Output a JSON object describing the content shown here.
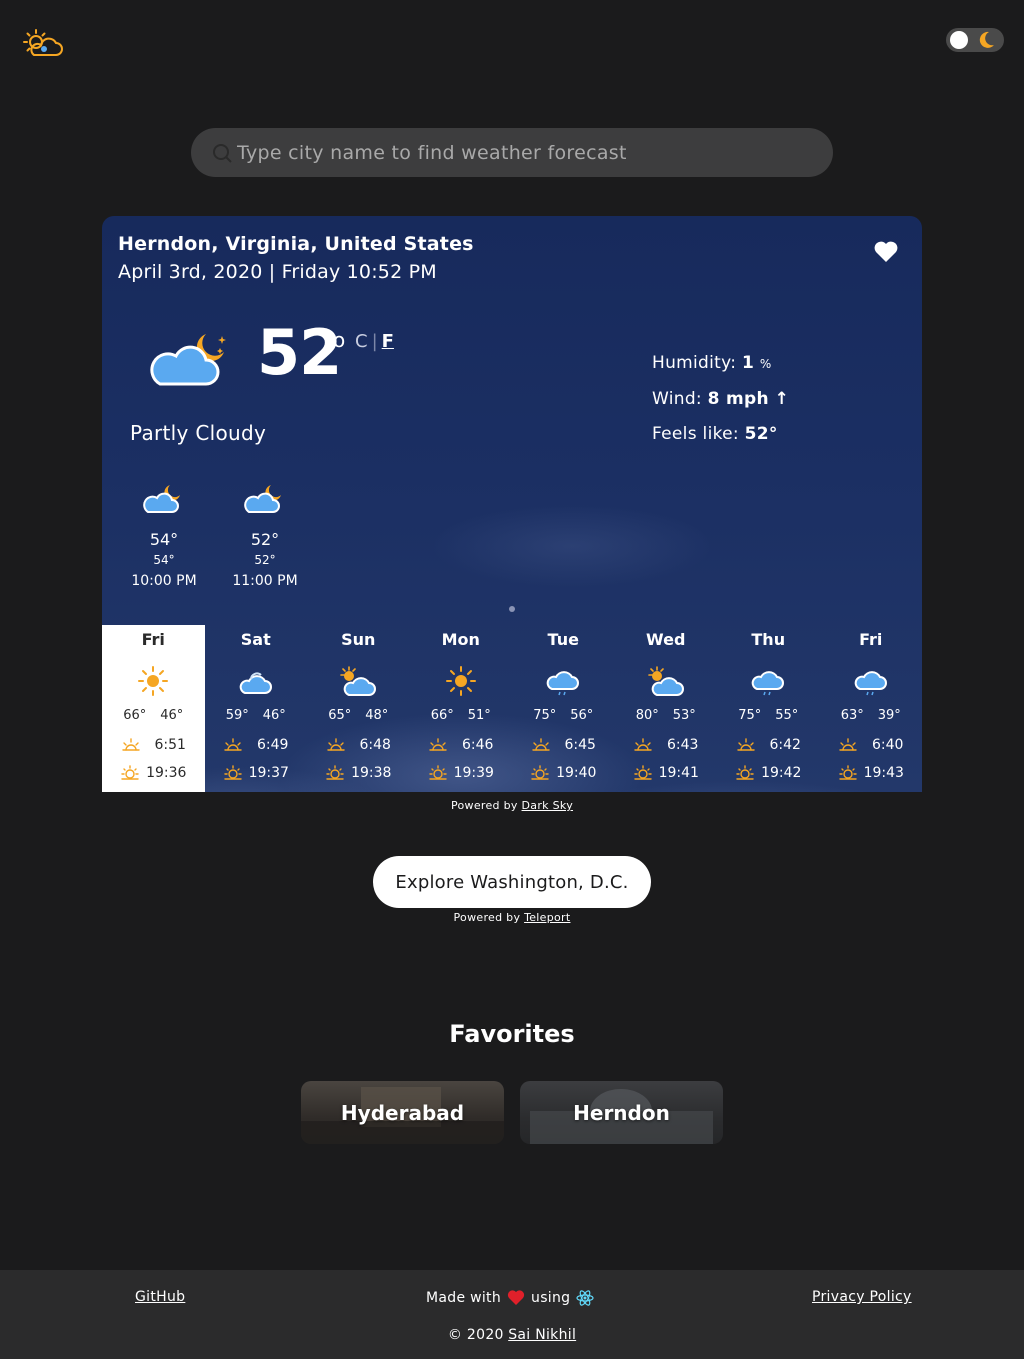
{
  "header": {
    "logo_icon": "weather-logo-icon",
    "theme_toggle_icon": "moon-icon"
  },
  "search": {
    "placeholder": "Type city name to find weather forecast"
  },
  "current": {
    "location": "Herndon, Virginia, United States",
    "datetime": "April 3rd, 2020 | Friday 10:52 PM",
    "temperature": "52",
    "degree": "o",
    "unit_c": "C",
    "unit_sep": "|",
    "unit_f": "F",
    "condition": "Partly Cloudy",
    "humidity_label": "Humidity:",
    "humidity_value": "1",
    "humidity_unit": "%",
    "wind_label": "Wind:",
    "wind_value": "8 mph",
    "wind_arrow": "↑",
    "feels_label": "Feels like:",
    "feels_value": "52°"
  },
  "hourly": [
    {
      "temp": "54°",
      "feels": "54°",
      "time": "10:00 PM",
      "icon": "partly-cloudy-night-icon"
    },
    {
      "temp": "52°",
      "feels": "52°",
      "time": "11:00 PM",
      "icon": "partly-cloudy-night-icon"
    }
  ],
  "daily": [
    {
      "day": "Fri",
      "high": "66°",
      "low": "46°",
      "sunrise": "6:51",
      "sunset": "19:36",
      "icon": "sun-icon"
    },
    {
      "day": "Sat",
      "high": "59°",
      "low": "46°",
      "sunrise": "6:49",
      "sunset": "19:37",
      "icon": "cloudy-icon"
    },
    {
      "day": "Sun",
      "high": "65°",
      "low": "48°",
      "sunrise": "6:48",
      "sunset": "19:38",
      "icon": "partly-cloudy-icon"
    },
    {
      "day": "Mon",
      "high": "66°",
      "low": "51°",
      "sunrise": "6:46",
      "sunset": "19:39",
      "icon": "sun-icon"
    },
    {
      "day": "Tue",
      "high": "75°",
      "low": "56°",
      "sunrise": "6:45",
      "sunset": "19:40",
      "icon": "rain-icon"
    },
    {
      "day": "Wed",
      "high": "80°",
      "low": "53°",
      "sunrise": "6:43",
      "sunset": "19:41",
      "icon": "partly-cloudy-icon"
    },
    {
      "day": "Thu",
      "high": "75°",
      "low": "55°",
      "sunrise": "6:42",
      "sunset": "19:42",
      "icon": "rain-icon"
    },
    {
      "day": "Fri",
      "high": "63°",
      "low": "39°",
      "sunrise": "6:40",
      "sunset": "19:43",
      "icon": "rain-icon"
    }
  ],
  "powered_darksky": {
    "prefix": "Powered by",
    "link": "Dark Sky"
  },
  "explore": {
    "label": "Explore Washington, D.C."
  },
  "powered_teleport": {
    "prefix": "Powered by",
    "link": "Teleport"
  },
  "favorites": {
    "title": "Favorites",
    "items": [
      "Hyderabad",
      "Herndon"
    ]
  },
  "footer": {
    "github": "GitHub",
    "made_prefix": "Made with",
    "made_using": "using",
    "privacy": "Privacy Policy",
    "copyright": "© 2020",
    "author": "Sai Nikhil"
  },
  "colors": {
    "background": "#1b1b1c",
    "card": "#1b2f63",
    "accent_sun": "#f5a623",
    "cloud": "#5aa9f0",
    "heart": "#e0202a",
    "react": "#61dafb"
  }
}
